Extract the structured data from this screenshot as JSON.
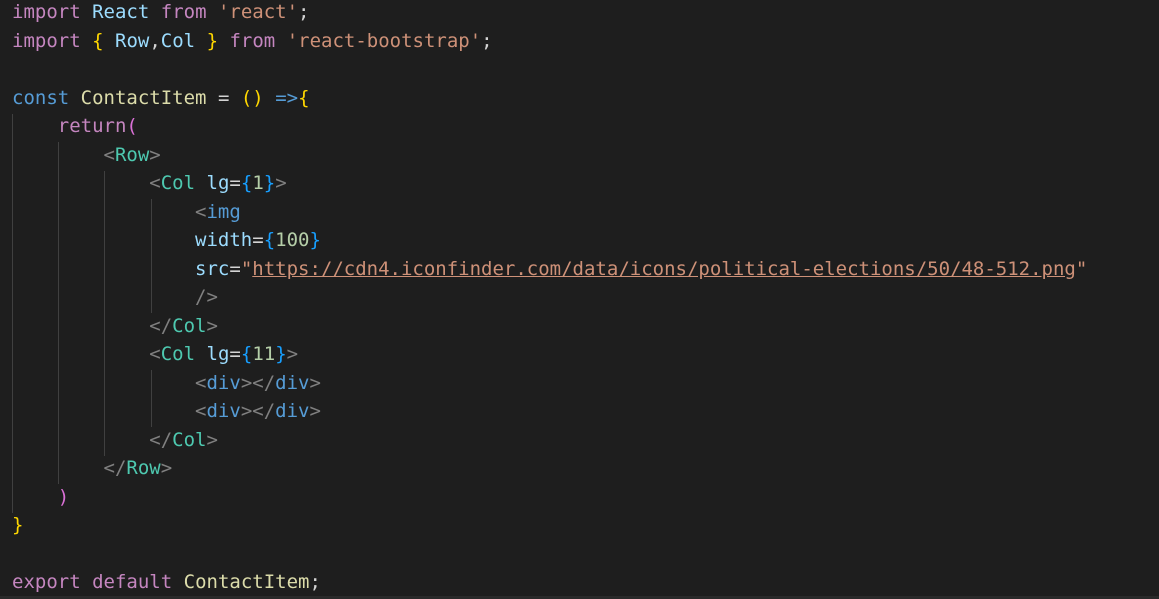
{
  "editor": {
    "theme": "dark",
    "background": "#1e1e1e",
    "colors": {
      "keyword": "#c586c0",
      "keyword_blue": "#569cd6",
      "variable": "#9cdcfe",
      "function": "#dcdcaa",
      "string": "#ce9178",
      "number": "#b5cea8",
      "component": "#4ec9b0",
      "bracket_gold": "#ffd700",
      "bracket_orchid": "#da70d6",
      "bracket_blue": "#179fff"
    },
    "lines": [
      [
        {
          "t": "import",
          "c": "kw"
        },
        {
          "t": " "
        },
        {
          "t": "React",
          "c": "var"
        },
        {
          "t": " "
        },
        {
          "t": "from",
          "c": "kw"
        },
        {
          "t": " "
        },
        {
          "t": "'react'",
          "c": "str"
        },
        {
          "t": ";"
        }
      ],
      [
        {
          "t": "import",
          "c": "kw"
        },
        {
          "t": " "
        },
        {
          "t": "{",
          "c": "b1"
        },
        {
          "t": " "
        },
        {
          "t": "Row",
          "c": "var"
        },
        {
          "t": ","
        },
        {
          "t": "Col",
          "c": "var"
        },
        {
          "t": " "
        },
        {
          "t": "}",
          "c": "b1"
        },
        {
          "t": " "
        },
        {
          "t": "from",
          "c": "kw"
        },
        {
          "t": " "
        },
        {
          "t": "'react-bootstrap'",
          "c": "str"
        },
        {
          "t": ";"
        }
      ],
      [],
      [
        {
          "t": "const",
          "c": "kw-blue"
        },
        {
          "t": " "
        },
        {
          "t": "ContactItem",
          "c": "fn"
        },
        {
          "t": " = "
        },
        {
          "t": "(",
          "c": "b1"
        },
        {
          "t": ")",
          "c": "b1"
        },
        {
          "t": " "
        },
        {
          "t": "=>",
          "c": "kw-blue"
        },
        {
          "t": "{",
          "c": "b1"
        }
      ],
      [
        {
          "t": "    "
        },
        {
          "t": "return",
          "c": "kw"
        },
        {
          "t": "(",
          "c": "b2"
        }
      ],
      [
        {
          "t": "        "
        },
        {
          "t": "<",
          "c": "angle"
        },
        {
          "t": "Row",
          "c": "tag"
        },
        {
          "t": ">",
          "c": "angle"
        }
      ],
      [
        {
          "t": "            "
        },
        {
          "t": "<",
          "c": "angle"
        },
        {
          "t": "Col",
          "c": "tag"
        },
        {
          "t": " "
        },
        {
          "t": "lg",
          "c": "var"
        },
        {
          "t": "="
        },
        {
          "t": "{",
          "c": "b3"
        },
        {
          "t": "1",
          "c": "num"
        },
        {
          "t": "}",
          "c": "b3"
        },
        {
          "t": ">",
          "c": "angle"
        }
      ],
      [
        {
          "t": "                "
        },
        {
          "t": "<",
          "c": "angle"
        },
        {
          "t": "img",
          "c": "tag-blue"
        }
      ],
      [
        {
          "t": "                "
        },
        {
          "t": "width",
          "c": "var"
        },
        {
          "t": "="
        },
        {
          "t": "{",
          "c": "b3"
        },
        {
          "t": "100",
          "c": "num"
        },
        {
          "t": "}",
          "c": "b3"
        }
      ],
      [
        {
          "t": "                "
        },
        {
          "t": "src",
          "c": "var"
        },
        {
          "t": "="
        },
        {
          "t": "\"",
          "c": "str"
        },
        {
          "t": "https://cdn4.iconfinder.com/data/icons/political-elections/50/48-512.png",
          "c": "str link"
        },
        {
          "t": "\"",
          "c": "str"
        }
      ],
      [
        {
          "t": "                "
        },
        {
          "t": "/>",
          "c": "angle"
        }
      ],
      [
        {
          "t": "            "
        },
        {
          "t": "</",
          "c": "angle"
        },
        {
          "t": "Col",
          "c": "tag"
        },
        {
          "t": ">",
          "c": "angle"
        }
      ],
      [
        {
          "t": "            "
        },
        {
          "t": "<",
          "c": "angle"
        },
        {
          "t": "Col",
          "c": "tag"
        },
        {
          "t": " "
        },
        {
          "t": "lg",
          "c": "var"
        },
        {
          "t": "="
        },
        {
          "t": "{",
          "c": "b3"
        },
        {
          "t": "11",
          "c": "num"
        },
        {
          "t": "}",
          "c": "b3"
        },
        {
          "t": ">",
          "c": "angle"
        }
      ],
      [
        {
          "t": "                "
        },
        {
          "t": "<",
          "c": "angle"
        },
        {
          "t": "div",
          "c": "tag-blue"
        },
        {
          "t": "></",
          "c": "angle"
        },
        {
          "t": "div",
          "c": "tag-blue"
        },
        {
          "t": ">",
          "c": "angle"
        }
      ],
      [
        {
          "t": "                "
        },
        {
          "t": "<",
          "c": "angle"
        },
        {
          "t": "div",
          "c": "tag-blue"
        },
        {
          "t": "></",
          "c": "angle"
        },
        {
          "t": "div",
          "c": "tag-blue"
        },
        {
          "t": ">",
          "c": "angle"
        }
      ],
      [
        {
          "t": "            "
        },
        {
          "t": "</",
          "c": "angle"
        },
        {
          "t": "Col",
          "c": "tag"
        },
        {
          "t": ">",
          "c": "angle"
        }
      ],
      [
        {
          "t": "        "
        },
        {
          "t": "</",
          "c": "angle"
        },
        {
          "t": "Row",
          "c": "tag"
        },
        {
          "t": ">",
          "c": "angle"
        }
      ],
      [
        {
          "t": "    "
        },
        {
          "t": ")",
          "c": "b2"
        }
      ],
      [
        {
          "t": "}",
          "c": "b1"
        }
      ],
      [],
      [
        {
          "t": "export",
          "c": "kw"
        },
        {
          "t": " "
        },
        {
          "t": "default",
          "c": "kw"
        },
        {
          "t": " "
        },
        {
          "t": "ContactItem",
          "c": "fn"
        },
        {
          "t": ";"
        }
      ]
    ]
  }
}
